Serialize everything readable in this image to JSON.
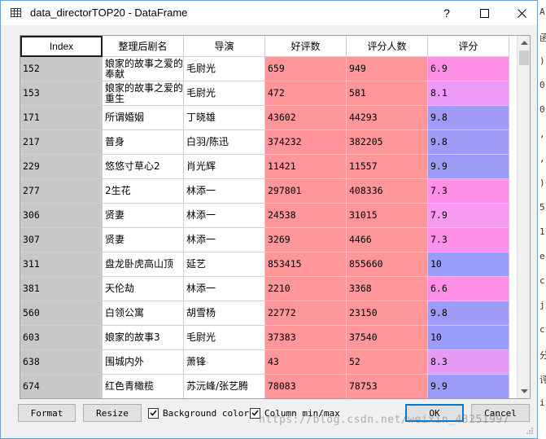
{
  "window": {
    "title": "data_directorTOP20 - DataFrame"
  },
  "table": {
    "columns": [
      "Index",
      "整理后剧名",
      "导演",
      "好评数",
      "评分人数",
      "评分"
    ],
    "rows": [
      {
        "index": "152",
        "name": "娘家的故事之爱的奉献",
        "director": "毛尉光",
        "good": "659",
        "raters": "949",
        "score": "6.9",
        "good_color": "#ff969a",
        "raters_color": "#ff969a",
        "score_color": "#ff90e6"
      },
      {
        "index": "153",
        "name": "娘家的故事之爱的重生",
        "director": "毛尉光",
        "good": "472",
        "raters": "581",
        "score": "8.1",
        "good_color": "#ff969a",
        "raters_color": "#ff969a",
        "score_color": "#ec9af6"
      },
      {
        "index": "171",
        "name": "所谓婚姻",
        "director": "丁晓雄",
        "good": "43602",
        "raters": "44293",
        "score": "9.8",
        "good_color": "#ff969a",
        "raters_color": "#ff969a",
        "score_color": "#9e9cf6"
      },
      {
        "index": "217",
        "name": "普身",
        "director": "白羽/陈迅",
        "good": "374232",
        "raters": "382205",
        "score": "9.8",
        "good_color": "#ff959a",
        "raters_color": "#ff969a",
        "score_color": "#9e9cf6"
      },
      {
        "index": "229",
        "name": "悠悠寸草心2",
        "director": "肖光辉",
        "good": "11421",
        "raters": "11557",
        "score": "9.9",
        "good_color": "#ff969a",
        "raters_color": "#ff969a",
        "score_color": "#9a9cf8"
      },
      {
        "index": "277",
        "name": "2生花",
        "director": "林添一",
        "good": "297801",
        "raters": "408336",
        "score": "7.3",
        "good_color": "#ff969a",
        "raters_color": "#ff969a",
        "score_color": "#ff92e8"
      },
      {
        "index": "306",
        "name": "贤妻",
        "director": "林添一",
        "good": "24538",
        "raters": "31015",
        "score": "7.9",
        "good_color": "#ff969a",
        "raters_color": "#ff969a",
        "score_color": "#f79af0"
      },
      {
        "index": "307",
        "name": "贤妻",
        "director": "林添一",
        "good": "3269",
        "raters": "4466",
        "score": "7.3",
        "good_color": "#ff969a",
        "raters_color": "#ff969a",
        "score_color": "#ff92e8"
      },
      {
        "index": "311",
        "name": "盘龙卧虎高山顶",
        "director": "延艺",
        "good": "853415",
        "raters": "855660",
        "score": "10",
        "good_color": "#ff969a",
        "raters_color": "#ff969a",
        "score_color": "#9a9cfa"
      },
      {
        "index": "381",
        "name": "天伦劫",
        "director": "林添一",
        "good": "2210",
        "raters": "3368",
        "score": "6.6",
        "good_color": "#ff969a",
        "raters_color": "#ff969a",
        "score_color": "#ff90e6"
      },
      {
        "index": "560",
        "name": "白领公寓",
        "director": "胡雪杨",
        "good": "22772",
        "raters": "23150",
        "score": "9.8",
        "good_color": "#ff969a",
        "raters_color": "#ff969a",
        "score_color": "#9e9cf6"
      },
      {
        "index": "603",
        "name": "娘家的故事3",
        "director": "毛尉光",
        "good": "37383",
        "raters": "37540",
        "score": "10",
        "good_color": "#ff969a",
        "raters_color": "#ff969a",
        "score_color": "#9a9cfa"
      },
      {
        "index": "638",
        "name": "围城内外",
        "director": "萧锋",
        "good": "43",
        "raters": "52",
        "score": "8.3",
        "good_color": "#ff969a",
        "raters_color": "#ff969a",
        "score_color": "#e69cf6"
      },
      {
        "index": "674",
        "name": "红色青橄榄",
        "director": "苏沅峰/张艺腾",
        "good": "78083",
        "raters": "78753",
        "score": "9.9",
        "good_color": "#ff969a",
        "raters_color": "#ff969a",
        "score_color": "#9a9cf8"
      }
    ]
  },
  "buttons": {
    "format": "Format",
    "resize": "Resize",
    "ok": "OK",
    "cancel": "Cancel"
  },
  "checkboxes": {
    "background_color": {
      "label": "Background color",
      "checked": true
    },
    "column_minmax": {
      "label": "Column min/max",
      "checked": true
    }
  },
  "watermark": "https://blog.csdn.net/weixin_43251997",
  "background_chars": [
    "A",
    "函",
    ")",
    "0",
    "0",
    ",",
    ",",
    ")",
    "5",
    "1",
    "e",
    "c",
    "j",
    "c",
    "分",
    "评",
    "ir"
  ]
}
